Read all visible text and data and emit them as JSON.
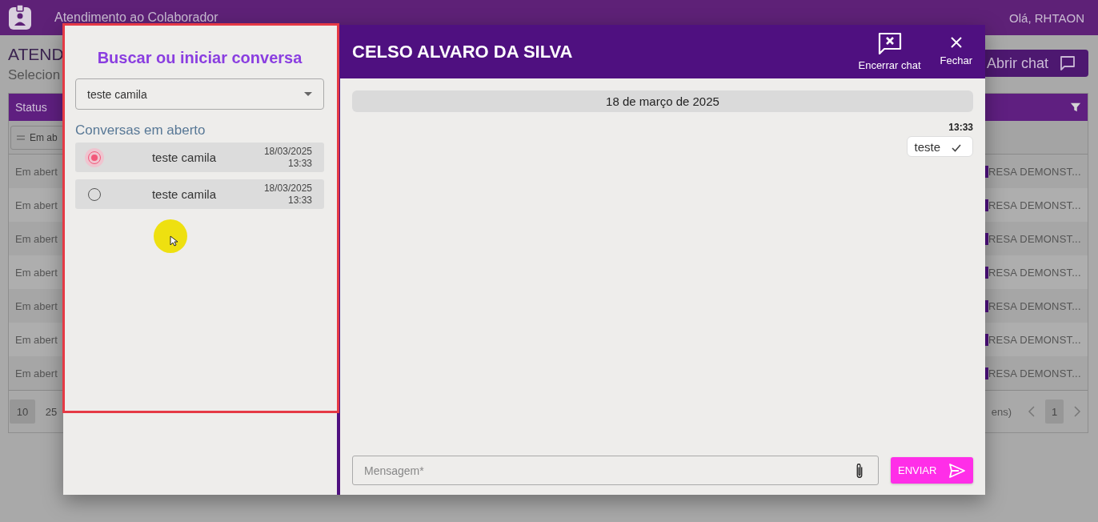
{
  "app_bar": {
    "title": "Atendimento ao Colaborador",
    "greeting": "Olá, RHTAON"
  },
  "page": {
    "heading": "ATEND",
    "subtitle": "Selecion",
    "open_chat_button": "Abrir chat"
  },
  "table": {
    "columns": [
      "Status"
    ],
    "filter": {
      "value": "Em ab"
    },
    "rows": [
      {
        "status": "Em abert",
        "column_2": "RESA DEMONST..."
      },
      {
        "status": "Em abert",
        "column_2": "RESA DEMONST..."
      },
      {
        "status": "Em abert",
        "column_2": "RESA DEMONST..."
      },
      {
        "status": "Em abert",
        "column_2": "RESA DEMONST..."
      },
      {
        "status": "Em abert",
        "column_2": "RESA DEMONST..."
      },
      {
        "status": "Em abert",
        "column_2": "RESA DEMONST..."
      },
      {
        "status": "Em abert",
        "column_2": "RESA DEMONST..."
      }
    ],
    "pagination": {
      "page_sizes": [
        {
          "label": "10",
          "selected": true
        },
        {
          "label": "25",
          "selected": false
        }
      ],
      "range_text": "ens)",
      "pages": [
        {
          "label": "1",
          "selected": true
        }
      ]
    }
  },
  "modal": {
    "search": {
      "title": "Buscar ou iniciar conversa",
      "select_value": "teste camila",
      "section_title": "Conversas em aberto",
      "conversations": [
        {
          "name": "teste camila",
          "date": "18/03/2025",
          "time": "13:33",
          "selected": true
        },
        {
          "name": "teste camila",
          "date": "18/03/2025",
          "time": "13:33",
          "selected": false
        }
      ]
    },
    "chat": {
      "contact": "CELSO ALVARO DA SILVA",
      "actions": [
        {
          "kind": "end",
          "label": "Encerrar chat"
        },
        {
          "kind": "close",
          "label": "Fechar"
        }
      ],
      "date_divider": "18 de março de 2025",
      "messages": [
        {
          "time": "13:33",
          "text": "teste",
          "delivered": true
        }
      ],
      "composer": {
        "placeholder": "Mensagem*"
      },
      "send_button": "ENVIAR"
    }
  }
}
